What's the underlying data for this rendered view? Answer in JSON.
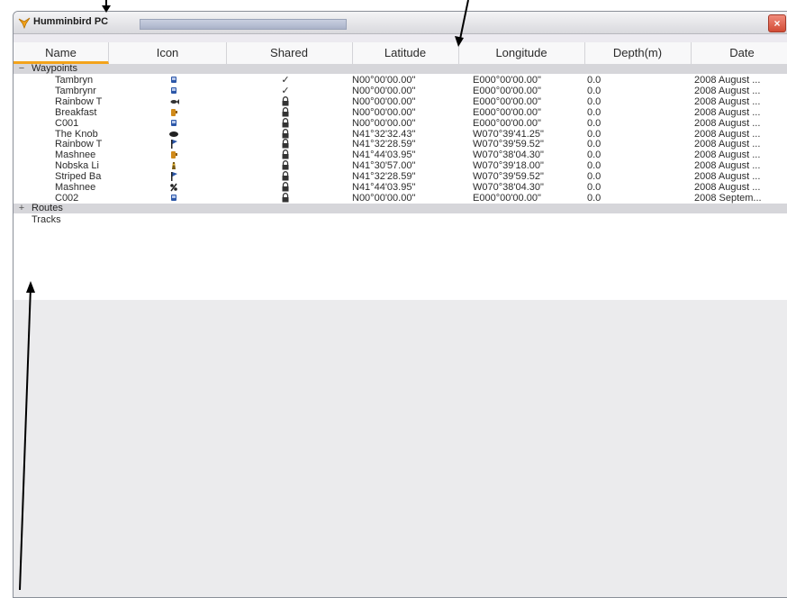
{
  "window": {
    "title": "Humminbird PC",
    "close_label": "×"
  },
  "columns": [
    "Name",
    "Icon",
    "Shared",
    "Latitude",
    "Longitude",
    "Depth(m)",
    "Date"
  ],
  "groups": {
    "waypoints": {
      "label": "Waypoints",
      "toggle": "−"
    },
    "routes": {
      "label": "Routes",
      "toggle": "+"
    },
    "tracks": {
      "label": "Tracks"
    }
  },
  "waypoints": [
    {
      "name": "Tambryn",
      "icon": "blue-square-icon",
      "shared": "✓",
      "lat": "N00°00'00.00\"",
      "lon": "E000°00'00.00\"",
      "depth": "0.0",
      "date": "2008 August ..."
    },
    {
      "name": "Tambrynr",
      "icon": "blue-square-icon",
      "shared": "✓",
      "lat": "N00°00'00.00\"",
      "lon": "E000°00'00.00\"",
      "depth": "0.0",
      "date": "2008 August ..."
    },
    {
      "name": "Rainbow T",
      "icon": "fish-icon",
      "shared": "lock",
      "lat": "N00°00'00.00\"",
      "lon": "E000°00'00.00\"",
      "depth": "0.0",
      "date": "2008 August ..."
    },
    {
      "name": "Breakfast",
      "icon": "mug-icon",
      "shared": "lock",
      "lat": "N00°00'00.00\"",
      "lon": "E000°00'00.00\"",
      "depth": "0.0",
      "date": "2008 August ..."
    },
    {
      "name": "C001",
      "icon": "blue-square-icon",
      "shared": "lock",
      "lat": "N00°00'00.00\"",
      "lon": "E000°00'00.00\"",
      "depth": "0.0",
      "date": "2008 August ..."
    },
    {
      "name": "The Knob",
      "icon": "rock-icon",
      "shared": "lock",
      "lat": "N41°32'32.43\"",
      "lon": "W070°39'41.25\"",
      "depth": "0.0",
      "date": "2008 August ..."
    },
    {
      "name": "Rainbow T",
      "icon": "flag-icon",
      "shared": "lock",
      "lat": "N41°32'28.59\"",
      "lon": "W070°39'59.52\"",
      "depth": "0.0",
      "date": "2008 August ..."
    },
    {
      "name": "Mashnee",
      "icon": "mug-icon",
      "shared": "lock",
      "lat": "N41°44'03.95\"",
      "lon": "W070°38'04.30\"",
      "depth": "0.0",
      "date": "2008 August ..."
    },
    {
      "name": "Nobska Li",
      "icon": "lighthouse-icon",
      "shared": "lock",
      "lat": "N41°30'57.00\"",
      "lon": "W070°39'18.00\"",
      "depth": "0.0",
      "date": "2008 August ..."
    },
    {
      "name": "Striped Ba",
      "icon": "flag-icon",
      "shared": "lock",
      "lat": "N41°32'28.59\"",
      "lon": "W070°39'59.52\"",
      "depth": "0.0",
      "date": "2008 August ..."
    },
    {
      "name": "Mashnee",
      "icon": "percent-icon",
      "shared": "lock",
      "lat": "N41°44'03.95\"",
      "lon": "W070°38'04.30\"",
      "depth": "0.0",
      "date": "2008 August ..."
    },
    {
      "name": "C002",
      "icon": "blue-square-icon",
      "shared": "lock",
      "lat": "N00°00'00.00\"",
      "lon": "E000°00'00.00\"",
      "depth": "0.0",
      "date": "2008 Septem..."
    }
  ]
}
